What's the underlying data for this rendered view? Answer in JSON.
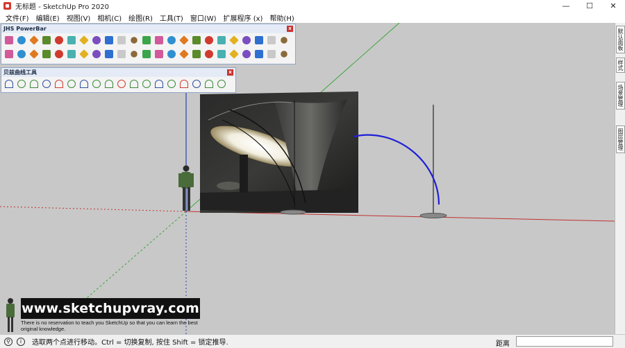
{
  "window": {
    "title": "无标题 - SketchUp Pro 2020",
    "controls": [
      "—",
      "☐",
      "✕"
    ]
  },
  "menu": [
    {
      "label": "文件(F)"
    },
    {
      "label": "编辑(E)"
    },
    {
      "label": "视图(V)"
    },
    {
      "label": "相机(C)"
    },
    {
      "label": "绘图(R)"
    },
    {
      "label": "工具(T)"
    },
    {
      "label": "窗口(W)"
    },
    {
      "label": "扩展程序 (x)"
    },
    {
      "label": "帮助(H)"
    }
  ],
  "toolbars": {
    "jhs": {
      "title": "JHS PowerBar",
      "close": "x"
    },
    "bezier": {
      "title": "贝兹曲线工具",
      "close": "x"
    }
  },
  "tray": {
    "tabs": [
      "默认面板",
      "样式",
      "场景管理",
      "图层管理"
    ]
  },
  "watermark": {
    "site": "www.sketchupvray.com",
    "tagline": "There is no reservation to teach you SketchUp so that you can learn the best original knowledge."
  },
  "status": {
    "message": "选取两个点进行移动。Ctrl = 切换复制, 按住 Shift = 锁定推导.",
    "measure_label": "距离",
    "measure_value": ""
  },
  "colors": {
    "viewport_bg": "#c8c8c8",
    "axis_red": "#c0302e",
    "axis_green": "#3ca53c",
    "axis_blue": "#2a3fb5",
    "curve_blue": "#1f1fd6"
  }
}
